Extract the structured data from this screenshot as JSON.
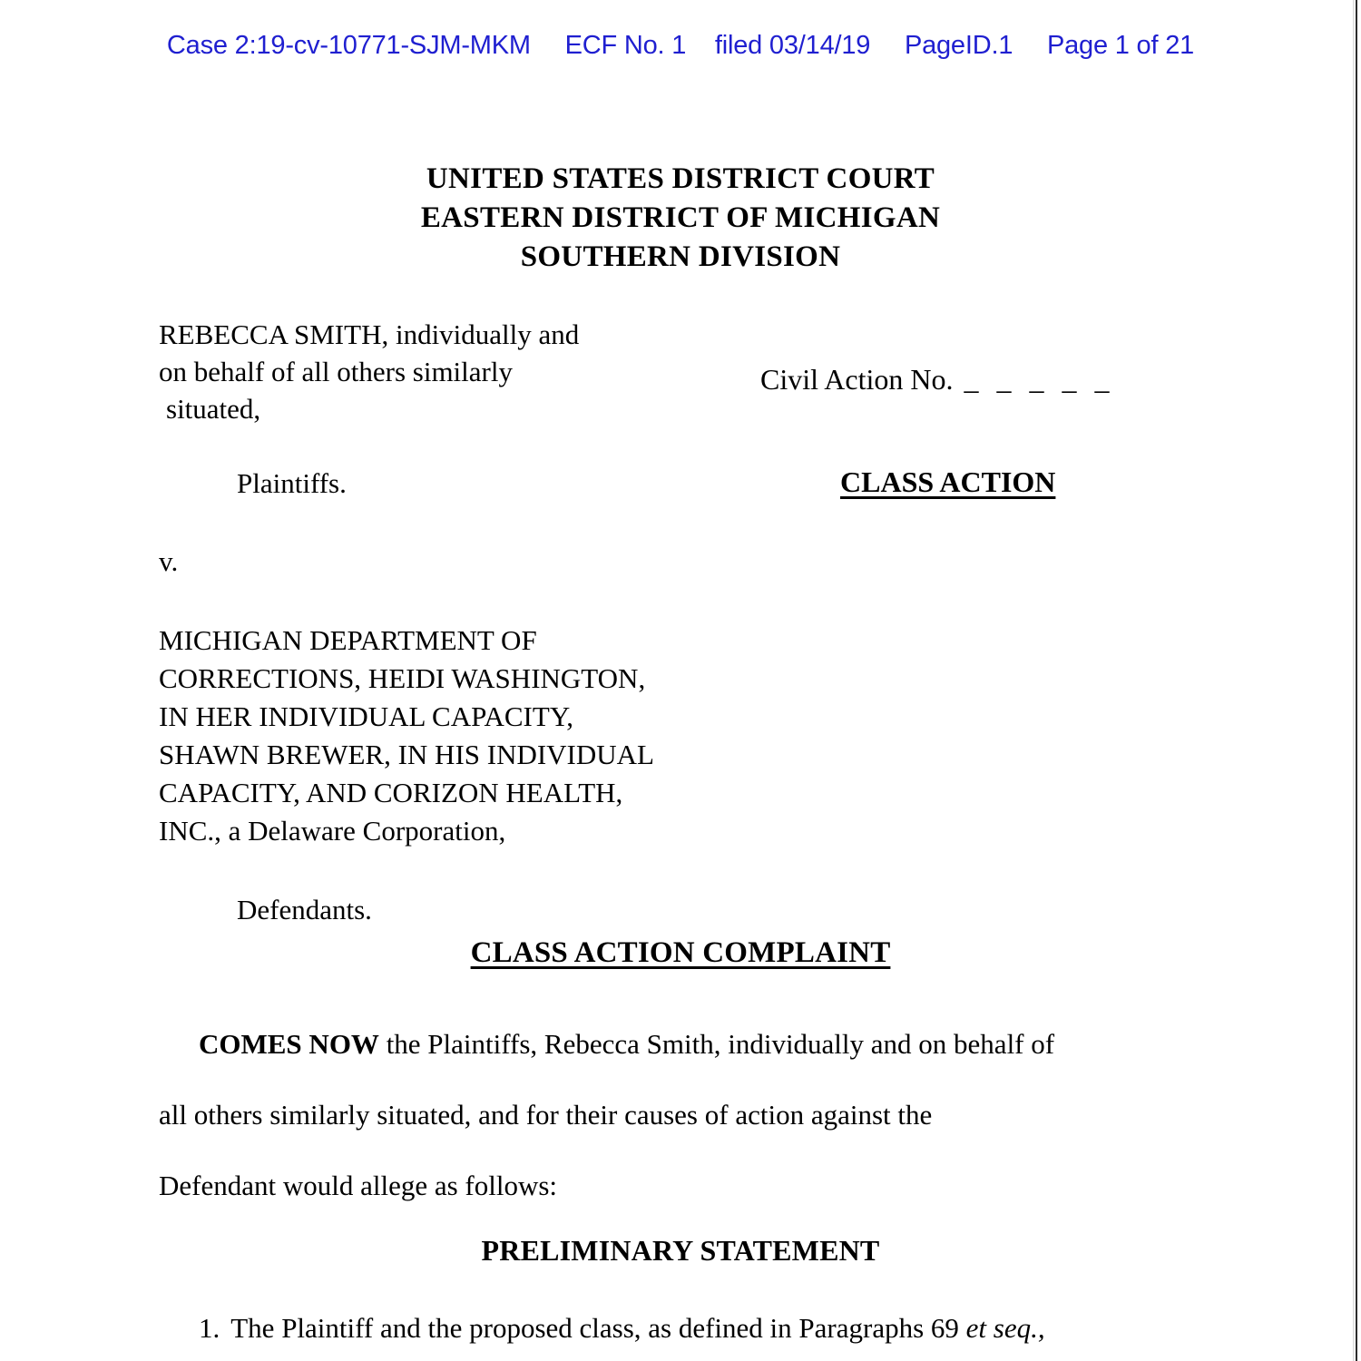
{
  "ecf_header": {
    "case": "Case 2:19-cv-10771-SJM-MKM",
    "ecf_no": "ECF No. 1",
    "filed": "filed 03/14/19",
    "page_id": "PageID.1",
    "page_of": "Page 1 of 21",
    "color": "#1f1fd0"
  },
  "court": {
    "line1": "UNITED STATES DISTRICT COURT",
    "line2": "EASTERN DISTRICT OF MICHIGAN",
    "line3": "SOUTHERN DIVISION"
  },
  "caption": {
    "plaintiff": {
      "line1": "REBECCA SMITH, individually and",
      "line2": "on behalf of all others similarly",
      "line3": "situated,",
      "role": "Plaintiffs."
    },
    "versus": "v.",
    "defendants": {
      "line1": "MICHIGAN DEPARTMENT OF",
      "line2": "CORRECTIONS, HEIDI WASHINGTON,",
      "line3": "IN HER INDIVIDUAL CAPACITY,",
      "line4": "SHAWN BREWER, IN HIS INDIVIDUAL",
      "line5": "CAPACITY, AND CORIZON HEALTH,",
      "line6": "INC., a Delaware Corporation,",
      "role": "Defendants."
    },
    "civil_action_label": "Civil Action No.",
    "civil_action_blank": "_ _ _ _ _",
    "class_action_tag": "CLASS ACTION"
  },
  "complaint": {
    "title": "CLASS ACTION COMPLAINT",
    "intro_bold": "COMES NOW",
    "intro_line1_rest": " the Plaintiffs, Rebecca Smith, individually and on behalf of",
    "intro_line2": "all others similarly situated, and for their causes of action against the",
    "intro_line3": "Defendant would allege as follows:"
  },
  "preliminary_statement": {
    "heading": "PRELIMINARY STATEMENT",
    "item_number": "1.",
    "item_text": "The Plaintiff and the proposed class, as defined in Paragraphs 69 ",
    "item_italic": "et seq.,"
  }
}
